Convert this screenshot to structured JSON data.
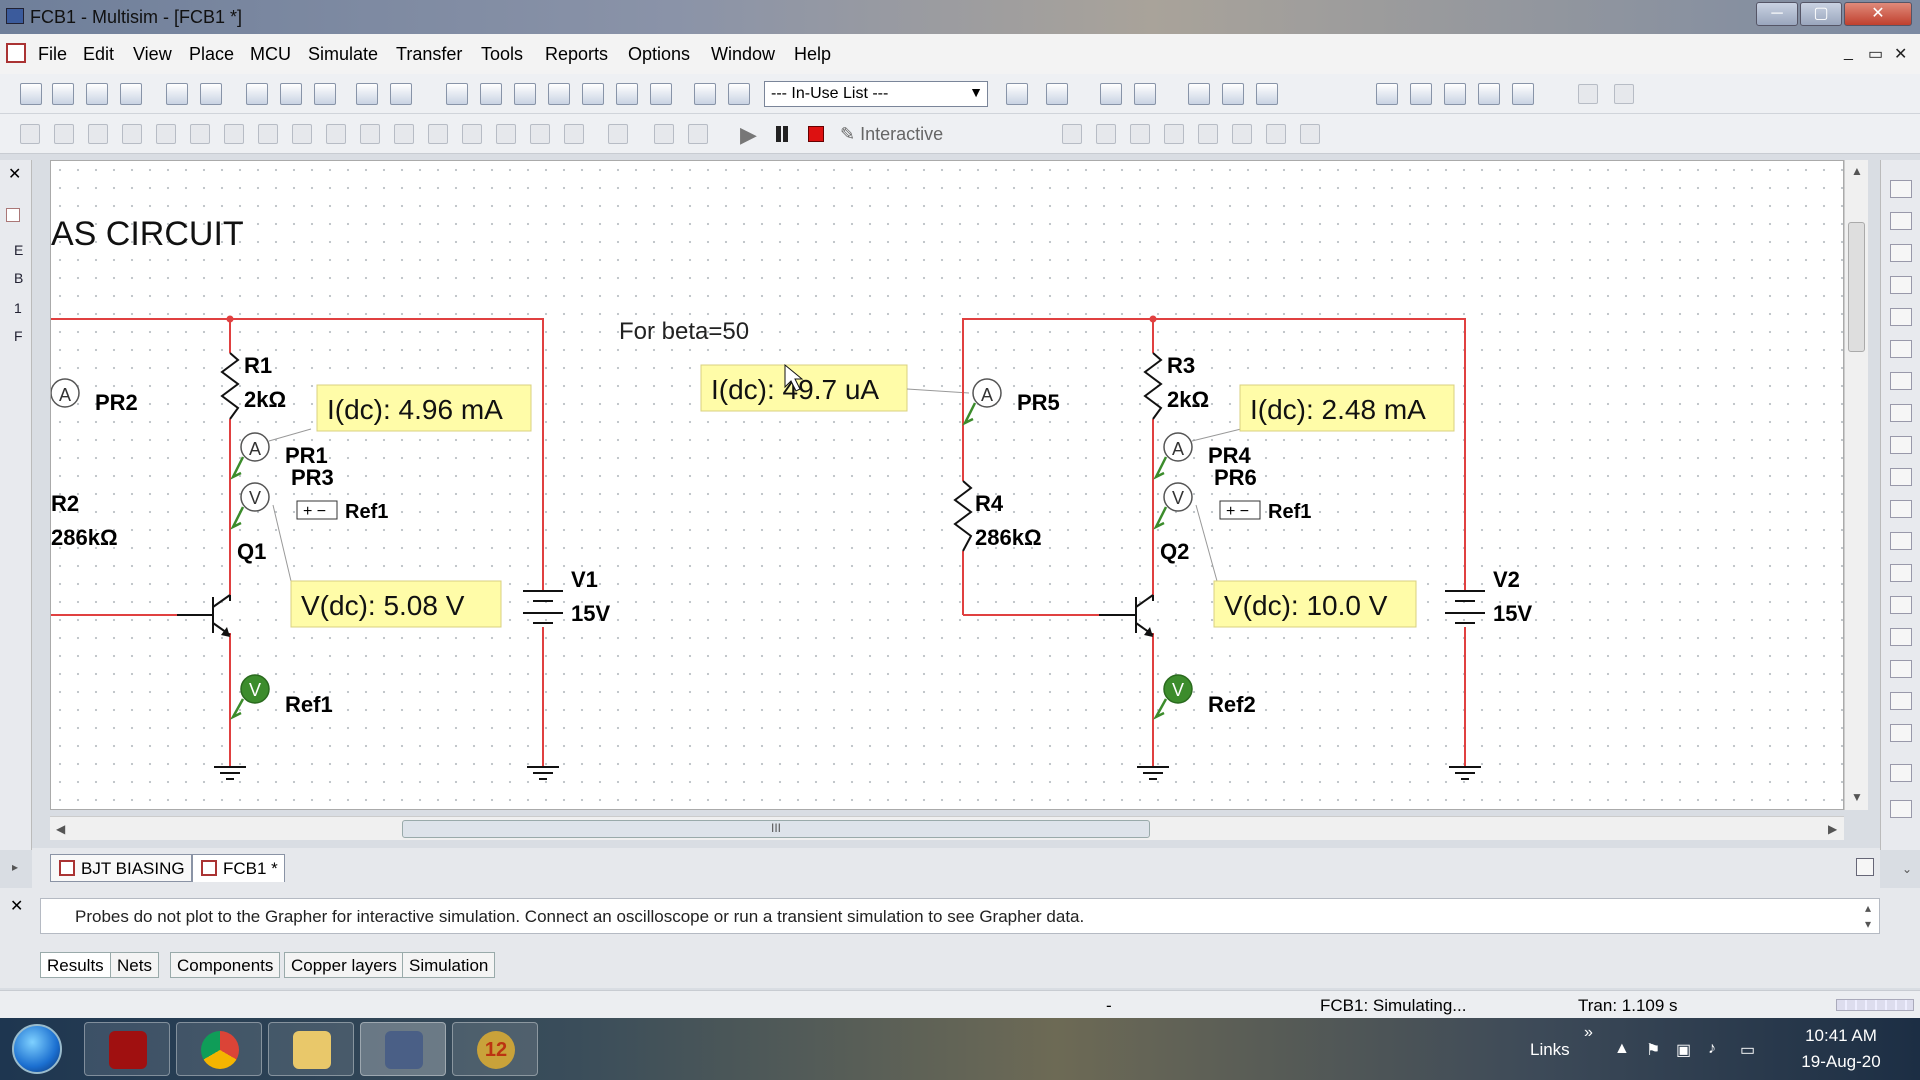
{
  "window": {
    "title": "FCB1 - Multisim - [FCB1 *]",
    "min": "─",
    "max": "▢",
    "close": "✕"
  },
  "menu": [
    "File",
    "Edit",
    "View",
    "Place",
    "MCU",
    "Simulate",
    "Transfer",
    "Tools",
    "Reports",
    "Options",
    "Window",
    "Help"
  ],
  "mdi_controls": [
    "_",
    "▭",
    "✕"
  ],
  "toolbar": {
    "in_use_list": "--- In-Use List ---",
    "interactive_label": "Interactive"
  },
  "left_strip": {
    "close": "✕",
    "labels": [
      "E",
      "B",
      "1",
      "F"
    ]
  },
  "schematic": {
    "title": "AS CIRCUIT",
    "note": "For beta=50",
    "resistors": [
      {
        "ref": "R1",
        "value": "2kΩ"
      },
      {
        "ref": "R2",
        "value": "286kΩ"
      },
      {
        "ref": "R3",
        "value": "2kΩ"
      },
      {
        "ref": "R4",
        "value": "286kΩ"
      }
    ],
    "transistors": [
      "Q1",
      "Q2"
    ],
    "sources": [
      {
        "ref": "V1",
        "value": "15V"
      },
      {
        "ref": "V2",
        "value": "15V"
      }
    ],
    "probes": [
      "PR2",
      "PR1",
      "PR3",
      "PR5",
      "PR4",
      "PR6"
    ],
    "refs": [
      "Ref1",
      "Ref1",
      "Ref1",
      "Ref2"
    ],
    "readouts": [
      "I(dc): 4.96 mA",
      "V(dc): 5.08 V",
      "I(dc): 49.7 uA",
      "I(dc): 2.48 mA",
      "V(dc): 10.0 V"
    ],
    "probe_letters": {
      "ammeter": "A",
      "voltmeter": "V"
    },
    "ref_box_label": "+ −"
  },
  "colors": {
    "wire": "#e04040",
    "readout_bg": "#fffca8",
    "probe_green": "#3c8c2c"
  },
  "hscroll_grip": "III",
  "sheet_tabs": [
    "BJT BIASING",
    "FCB1 *"
  ],
  "output": {
    "close": "✕",
    "message": "Probes do not plot to the Grapher for interactive simulation. Connect an oscilloscope or run a transient simulation to see Grapher data.",
    "tabs": [
      "Results",
      "Nets",
      "Components",
      "Copper layers",
      "Simulation"
    ]
  },
  "status": {
    "dash": "-",
    "state": "FCB1: Simulating...",
    "tran": "Tran: 1.109 s"
  },
  "taskbar": {
    "links": "Links",
    "time": "10:41 AM",
    "date": "19-Aug-20",
    "app_badge": "12"
  }
}
